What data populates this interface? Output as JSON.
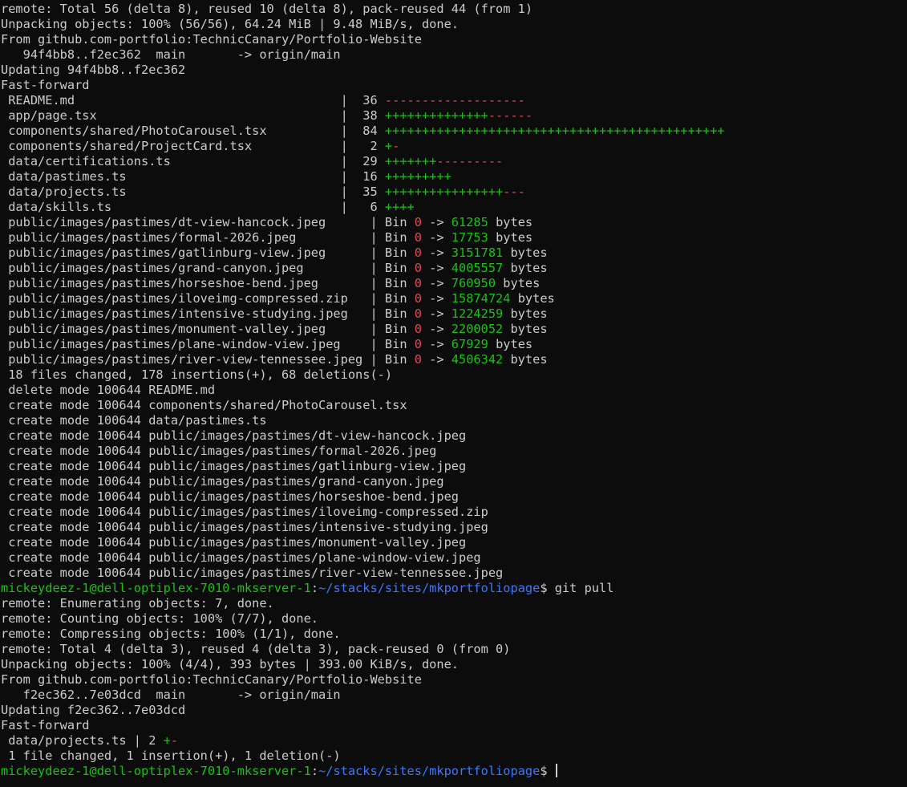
{
  "terminal": {
    "lines": [
      [
        {
          "t": "remote: Total 56 (delta 8), reused 10 (delta 8), pack-reused 44 (from 1)"
        }
      ],
      [
        {
          "t": "Unpacking objects: 100% (56/56), 64.24 MiB | 9.48 MiB/s, done."
        }
      ],
      [
        {
          "t": "From github.com-portfolio:TechnicCanary/Portfolio-Website"
        }
      ],
      [
        {
          "t": "   94f4bb8..f2ec362  main       -> origin/main"
        }
      ],
      [
        {
          "t": "Updating 94f4bb8..f2ec362"
        }
      ],
      [
        {
          "t": "Fast-forward"
        }
      ],
      [
        {
          "t": " README.md                                    |  36 "
        },
        {
          "t": "-------------------",
          "c": "r"
        }
      ],
      [
        {
          "t": " app/page.tsx                                 |  38 "
        },
        {
          "t": "++++++++++++++",
          "c": "g"
        },
        {
          "t": "------",
          "c": "r"
        }
      ],
      [
        {
          "t": " components/shared/PhotoCarousel.tsx          |  84 "
        },
        {
          "t": "++++++++++++++++++++++++++++++++++++++++++++++",
          "c": "g"
        }
      ],
      [
        {
          "t": " components/shared/ProjectCard.tsx            |   2 "
        },
        {
          "t": "+",
          "c": "g"
        },
        {
          "t": "-",
          "c": "r"
        }
      ],
      [
        {
          "t": " data/certifications.ts                       |  29 "
        },
        {
          "t": "+++++++",
          "c": "g"
        },
        {
          "t": "---------",
          "c": "r"
        }
      ],
      [
        {
          "t": " data/pastimes.ts                             |  16 "
        },
        {
          "t": "+++++++++",
          "c": "g"
        }
      ],
      [
        {
          "t": " data/projects.ts                             |  35 "
        },
        {
          "t": "++++++++++++++++",
          "c": "g"
        },
        {
          "t": "---",
          "c": "r"
        }
      ],
      [
        {
          "t": " data/skills.ts                               |   6 "
        },
        {
          "t": "++++",
          "c": "g"
        }
      ],
      [
        {
          "t": " public/images/pastimes/dt-view-hancock.jpeg      | Bin "
        },
        {
          "t": "0",
          "c": "r"
        },
        {
          "t": " -> "
        },
        {
          "t": "61285",
          "c": "g"
        },
        {
          "t": " bytes"
        }
      ],
      [
        {
          "t": " public/images/pastimes/formal-2026.jpeg          | Bin "
        },
        {
          "t": "0",
          "c": "r"
        },
        {
          "t": " -> "
        },
        {
          "t": "17753",
          "c": "g"
        },
        {
          "t": " bytes"
        }
      ],
      [
        {
          "t": " public/images/pastimes/gatlinburg-view.jpeg      | Bin "
        },
        {
          "t": "0",
          "c": "r"
        },
        {
          "t": " -> "
        },
        {
          "t": "3151781",
          "c": "g"
        },
        {
          "t": " bytes"
        }
      ],
      [
        {
          "t": " public/images/pastimes/grand-canyon.jpeg         | Bin "
        },
        {
          "t": "0",
          "c": "r"
        },
        {
          "t": " -> "
        },
        {
          "t": "4005557",
          "c": "g"
        },
        {
          "t": " bytes"
        }
      ],
      [
        {
          "t": " public/images/pastimes/horseshoe-bend.jpeg       | Bin "
        },
        {
          "t": "0",
          "c": "r"
        },
        {
          "t": " -> "
        },
        {
          "t": "760950",
          "c": "g"
        },
        {
          "t": " bytes"
        }
      ],
      [
        {
          "t": " public/images/pastimes/iloveimg-compressed.zip   | Bin "
        },
        {
          "t": "0",
          "c": "r"
        },
        {
          "t": " -> "
        },
        {
          "t": "15874724",
          "c": "g"
        },
        {
          "t": " bytes"
        }
      ],
      [
        {
          "t": " public/images/pastimes/intensive-studying.jpeg   | Bin "
        },
        {
          "t": "0",
          "c": "r"
        },
        {
          "t": " -> "
        },
        {
          "t": "1224259",
          "c": "g"
        },
        {
          "t": " bytes"
        }
      ],
      [
        {
          "t": " public/images/pastimes/monument-valley.jpeg      | Bin "
        },
        {
          "t": "0",
          "c": "r"
        },
        {
          "t": " -> "
        },
        {
          "t": "2200052",
          "c": "g"
        },
        {
          "t": " bytes"
        }
      ],
      [
        {
          "t": " public/images/pastimes/plane-window-view.jpeg    | Bin "
        },
        {
          "t": "0",
          "c": "r"
        },
        {
          "t": " -> "
        },
        {
          "t": "67929",
          "c": "g"
        },
        {
          "t": " bytes"
        }
      ],
      [
        {
          "t": " public/images/pastimes/river-view-tennessee.jpeg | Bin "
        },
        {
          "t": "0",
          "c": "r"
        },
        {
          "t": " -> "
        },
        {
          "t": "4506342",
          "c": "g"
        },
        {
          "t": " bytes"
        }
      ],
      [
        {
          "t": " 18 files changed, 178 insertions(+), 68 deletions(-)"
        }
      ],
      [
        {
          "t": " delete mode 100644 README.md"
        }
      ],
      [
        {
          "t": " create mode 100644 components/shared/PhotoCarousel.tsx"
        }
      ],
      [
        {
          "t": " create mode 100644 data/pastimes.ts"
        }
      ],
      [
        {
          "t": " create mode 100644 public/images/pastimes/dt-view-hancock.jpeg"
        }
      ],
      [
        {
          "t": " create mode 100644 public/images/pastimes/formal-2026.jpeg"
        }
      ],
      [
        {
          "t": " create mode 100644 public/images/pastimes/gatlinburg-view.jpeg"
        }
      ],
      [
        {
          "t": " create mode 100644 public/images/pastimes/grand-canyon.jpeg"
        }
      ],
      [
        {
          "t": " create mode 100644 public/images/pastimes/horseshoe-bend.jpeg"
        }
      ],
      [
        {
          "t": " create mode 100644 public/images/pastimes/iloveimg-compressed.zip"
        }
      ],
      [
        {
          "t": " create mode 100644 public/images/pastimes/intensive-studying.jpeg"
        }
      ],
      [
        {
          "t": " create mode 100644 public/images/pastimes/monument-valley.jpeg"
        }
      ],
      [
        {
          "t": " create mode 100644 public/images/pastimes/plane-window-view.jpeg"
        }
      ],
      [
        {
          "t": " create mode 100644 public/images/pastimes/river-view-tennessee.jpeg"
        }
      ],
      [
        {
          "t": "mickeydeez-1@dell-optiplex-7010-mkserver-1",
          "c": "g"
        },
        {
          "t": ":"
        },
        {
          "t": "~/stacks/sites/mkportfoliopage",
          "c": "b"
        },
        {
          "t": "$ git pull"
        }
      ],
      [
        {
          "t": "remote: Enumerating objects: 7, done."
        }
      ],
      [
        {
          "t": "remote: Counting objects: 100% (7/7), done."
        }
      ],
      [
        {
          "t": "remote: Compressing objects: 100% (1/1), done."
        }
      ],
      [
        {
          "t": "remote: Total 4 (delta 3), reused 4 (delta 3), pack-reused 0 (from 0)"
        }
      ],
      [
        {
          "t": "Unpacking objects: 100% (4/4), 393 bytes | 393.00 KiB/s, done."
        }
      ],
      [
        {
          "t": "From github.com-portfolio:TechnicCanary/Portfolio-Website"
        }
      ],
      [
        {
          "t": "   f2ec362..7e03dcd  main       -> origin/main"
        }
      ],
      [
        {
          "t": "Updating f2ec362..7e03dcd"
        }
      ],
      [
        {
          "t": "Fast-forward"
        }
      ],
      [
        {
          "t": " data/projects.ts | 2 "
        },
        {
          "t": "+",
          "c": "g"
        },
        {
          "t": "-",
          "c": "r"
        }
      ],
      [
        {
          "t": " 1 file changed, 1 insertion(+), 1 deletion(-)"
        }
      ],
      [
        {
          "t": "mickeydeez-1@dell-optiplex-7010-mkserver-1",
          "c": "g"
        },
        {
          "t": ":"
        },
        {
          "t": "~/stacks/sites/mkportfoliopage",
          "c": "b"
        },
        {
          "t": "$ "
        }
      ]
    ]
  },
  "colors": {
    "background": "#0c0c0c",
    "foreground": "#cccccc",
    "green": "#16c60c",
    "red": "#e74856",
    "blue": "#3b78ff"
  }
}
